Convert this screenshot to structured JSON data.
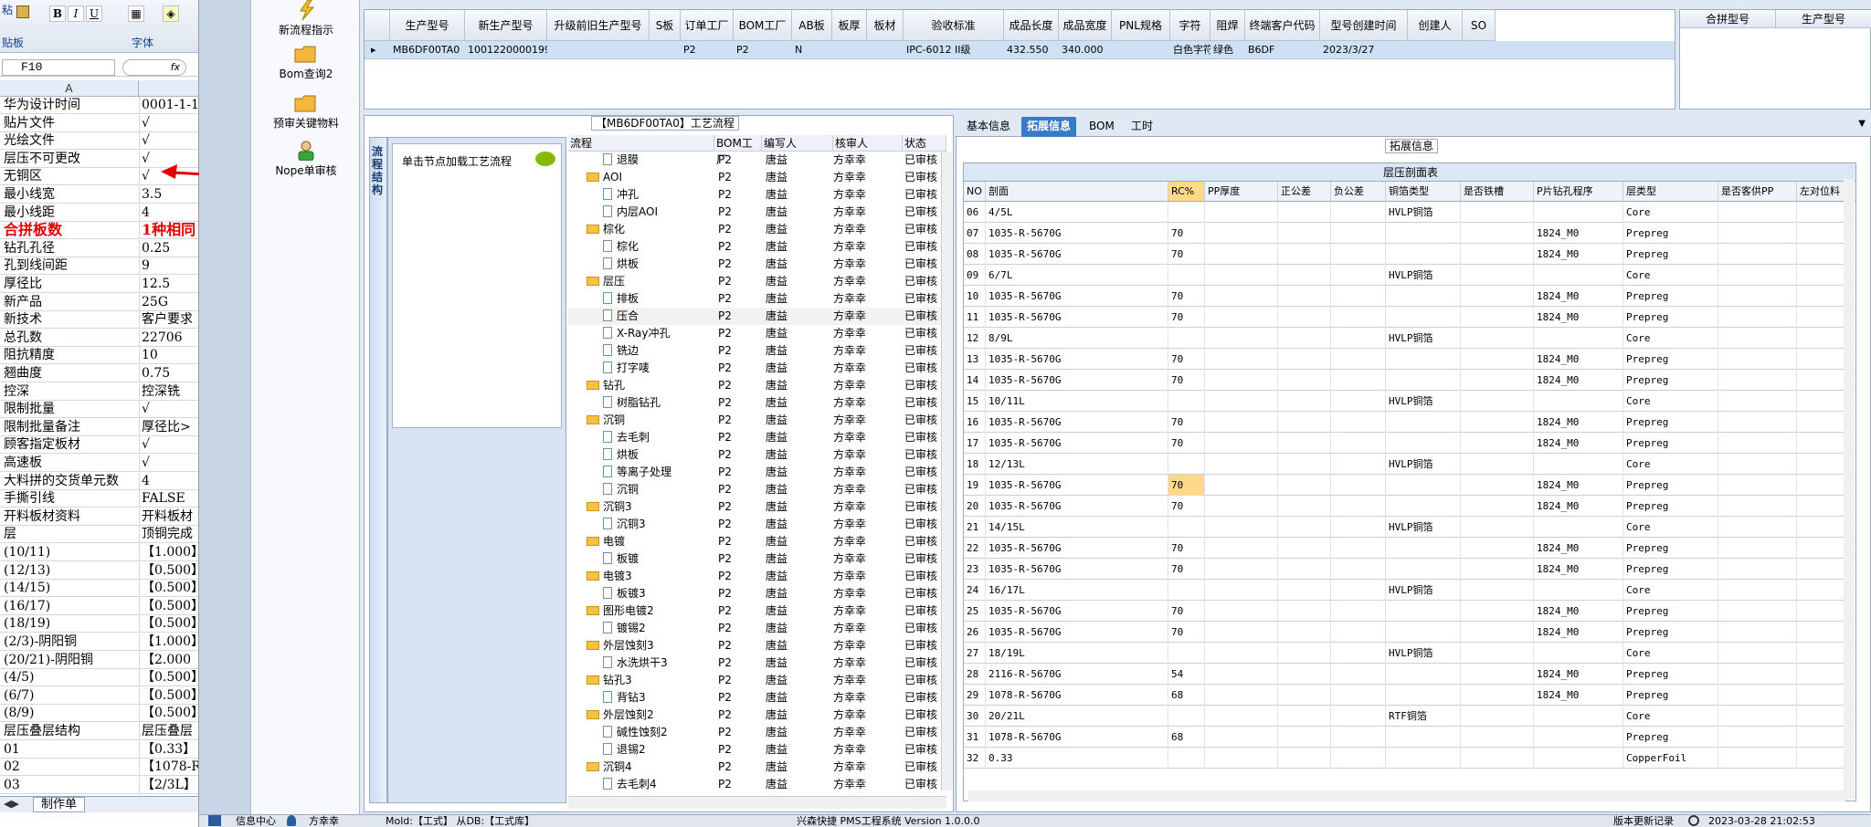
{
  "excel": {
    "ribbon": {
      "group_label": "字体",
      "left_label": "粘",
      "left_label2": "贴板",
      "bold": "B",
      "italic": "I",
      "underline": "U"
    },
    "name_box": "F10",
    "fx": "fx",
    "column_a": "A",
    "rows": [
      [
        "华为设计时间",
        "0001-1-1"
      ],
      [
        "贴片文件",
        "√"
      ],
      [
        "光绘文件",
        "√"
      ],
      [
        "层压不可更改",
        "√"
      ],
      [
        "无铜区",
        "√"
      ],
      [
        "最小线宽",
        "3.5"
      ],
      [
        "最小线距",
        "4"
      ],
      [
        "合拼板数",
        "1种相同"
      ],
      [
        "钻孔孔径",
        "0.25"
      ],
      [
        "孔到线间距",
        "9"
      ],
      [
        "厚径比",
        "12.5"
      ],
      [
        "新产品",
        "25G"
      ],
      [
        "新技术",
        "客户要求"
      ],
      [
        "总孔数",
        "22706"
      ],
      [
        "阻抗精度",
        "10"
      ],
      [
        "翘曲度",
        "0.75"
      ],
      [
        "控深",
        "控深铣"
      ],
      [
        "限制批量",
        "√"
      ],
      [
        "限制批量备注",
        "厚径比>"
      ],
      [
        "顾客指定板材",
        "√"
      ],
      [
        "高速板",
        "√"
      ],
      [
        "大料拼的交货单元数",
        "4"
      ],
      [
        "手撕引线",
        "FALSE"
      ],
      [
        "开料板材资料",
        "开料板材"
      ],
      [
        "层",
        "顶铜完成"
      ],
      [
        "(10/11)",
        "【1.000】"
      ],
      [
        "(12/13)",
        "【0.500】"
      ],
      [
        "(14/15)",
        "【0.500】"
      ],
      [
        "(16/17)",
        "【0.500】"
      ],
      [
        "(18/19)",
        "【0.500】"
      ],
      [
        "(2/3)-阴阳铜",
        "【1.000】"
      ],
      [
        "(20/21)-阴阳铜",
        "【2.000"
      ],
      [
        "(4/5)",
        "【0.500】"
      ],
      [
        "(6/7)",
        "【0.500】"
      ],
      [
        "(8/9)",
        "【0.500】"
      ],
      [
        "层压叠层结构",
        "层压叠层"
      ],
      [
        "01",
        "【0.33】"
      ],
      [
        "02",
        "【1078-R"
      ],
      [
        "03",
        "【2/3L】"
      ]
    ],
    "sheet_tab": "制作单"
  },
  "nav": {
    "items": [
      "新流程指示",
      "Bom查询2",
      "预审关键物料",
      "Nope单审核"
    ]
  },
  "top_grid": {
    "headers": [
      "生产型号",
      "新生产型号",
      "升级前旧生产型号",
      "S板",
      "订单工厂",
      "BOM工厂",
      "AB板",
      "板厚",
      "板材",
      "验收标准",
      "成品长度",
      "成品宽度",
      "PNL规格",
      "字符",
      "阻焊",
      "终端客户代码",
      "型号创建时间",
      "创建人",
      "SO"
    ],
    "row": [
      "MB6DF00TA0",
      "10012200001995",
      "",
      "",
      "P2",
      "P2",
      "N",
      "",
      "",
      "IPC-6012 II级",
      "432.550",
      "340.000",
      "",
      "白色字符",
      "绿色",
      "B6DF",
      "2023/3/27",
      "",
      ""
    ],
    "right_headers": [
      "合拼型号",
      "生产型号"
    ]
  },
  "process": {
    "title": "【MB6DF00TA0】工艺流程",
    "side_tab": "流程结构",
    "click_label": "单击节点加载工艺流程",
    "headers": [
      "流程",
      "BOM工厂",
      "编写人",
      "核审人",
      "状态"
    ],
    "nodes": [
      {
        "name": "退膜",
        "level": 2,
        "folder": false
      },
      {
        "name": "AOI",
        "level": 1,
        "folder": true
      },
      {
        "name": "冲孔",
        "level": 2,
        "folder": false
      },
      {
        "name": "内层AOI",
        "level": 2,
        "folder": false
      },
      {
        "name": "棕化",
        "level": 1,
        "folder": true
      },
      {
        "name": "棕化",
        "level": 2,
        "folder": false
      },
      {
        "name": "烘板",
        "level": 2,
        "folder": false
      },
      {
        "name": "层压",
        "level": 1,
        "folder": true
      },
      {
        "name": "排板",
        "level": 2,
        "folder": false
      },
      {
        "name": "压合",
        "level": 2,
        "folder": false,
        "selected": true
      },
      {
        "name": "X-Ray冲孔",
        "level": 2,
        "folder": false
      },
      {
        "name": "铣边",
        "level": 2,
        "folder": false
      },
      {
        "name": "打字唛",
        "level": 2,
        "folder": false
      },
      {
        "name": "钻孔",
        "level": 1,
        "folder": true
      },
      {
        "name": "树脂钻孔",
        "level": 2,
        "folder": false
      },
      {
        "name": "沉铜",
        "level": 1,
        "folder": true
      },
      {
        "name": "去毛刺",
        "level": 2,
        "folder": false
      },
      {
        "name": "烘板",
        "level": 2,
        "folder": false
      },
      {
        "name": "等离子处理",
        "level": 2,
        "folder": false
      },
      {
        "name": "沉铜",
        "level": 2,
        "folder": false
      },
      {
        "name": "沉铜3",
        "level": 1,
        "folder": true
      },
      {
        "name": "沉铜3",
        "level": 2,
        "folder": false
      },
      {
        "name": "电镀",
        "level": 1,
        "folder": true
      },
      {
        "name": "板镀",
        "level": 2,
        "folder": false
      },
      {
        "name": "电镀3",
        "level": 1,
        "folder": true
      },
      {
        "name": "板镀3",
        "level": 2,
        "folder": false
      },
      {
        "name": "图形电镀2",
        "level": 1,
        "folder": true
      },
      {
        "name": "镀锡2",
        "level": 2,
        "folder": false
      },
      {
        "name": "外层蚀刻3",
        "level": 1,
        "folder": true
      },
      {
        "name": "水洗烘干3",
        "level": 2,
        "folder": false
      },
      {
        "name": "钻孔3",
        "level": 1,
        "folder": true
      },
      {
        "name": "背钻3",
        "level": 2,
        "folder": false
      },
      {
        "name": "外层蚀刻2",
        "level": 1,
        "folder": true
      },
      {
        "name": "碱性蚀刻2",
        "level": 2,
        "folder": false
      },
      {
        "name": "退锡2",
        "level": 2,
        "folder": false
      },
      {
        "name": "沉铜4",
        "level": 1,
        "folder": true
      },
      {
        "name": "去毛刺4",
        "level": 2,
        "folder": false
      }
    ],
    "bom_factory": "P2",
    "writer": "唐益",
    "reviewer": "方幸幸",
    "status": "已审核"
  },
  "detail": {
    "tabs": [
      "基本信息",
      "拓展信息",
      "BOM",
      "工时"
    ],
    "active_tab": 1,
    "ext_label": "拓展信息",
    "table_title": "层压剖面表",
    "headers": [
      "NO",
      "剖面",
      "RC%",
      "PP厚度",
      "正公差",
      "负公差",
      "铜箔类型",
      "是否铁槽",
      "P片钻孔程序",
      "层类型",
      "是否客供PP",
      "左对位料"
    ],
    "rows": [
      [
        "06",
        "4/5L",
        "",
        "",
        "",
        "",
        "HVLP铜箔",
        "",
        "",
        "Core",
        "",
        ""
      ],
      [
        "07",
        "1035-R-5670G",
        "70",
        "",
        "",
        "",
        "",
        "",
        "1824_M0",
        "Prepreg",
        "",
        ""
      ],
      [
        "08",
        "1035-R-5670G",
        "70",
        "",
        "",
        "",
        "",
        "",
        "1824_M0",
        "Prepreg",
        "",
        ""
      ],
      [
        "09",
        "6/7L",
        "",
        "",
        "",
        "",
        "HVLP铜箔",
        "",
        "",
        "Core",
        "",
        ""
      ],
      [
        "10",
        "1035-R-5670G",
        "70",
        "",
        "",
        "",
        "",
        "",
        "1824_M0",
        "Prepreg",
        "",
        ""
      ],
      [
        "11",
        "1035-R-5670G",
        "70",
        "",
        "",
        "",
        "",
        "",
        "1824_M0",
        "Prepreg",
        "",
        ""
      ],
      [
        "12",
        "8/9L",
        "",
        "",
        "",
        "",
        "HVLP铜箔",
        "",
        "",
        "Core",
        "",
        ""
      ],
      [
        "13",
        "1035-R-5670G",
        "70",
        "",
        "",
        "",
        "",
        "",
        "1824_M0",
        "Prepreg",
        "",
        ""
      ],
      [
        "14",
        "1035-R-5670G",
        "70",
        "",
        "",
        "",
        "",
        "",
        "1824_M0",
        "Prepreg",
        "",
        ""
      ],
      [
        "15",
        "10/11L",
        "",
        "",
        "",
        "",
        "HVLP铜箔",
        "",
        "",
        "Core",
        "",
        ""
      ],
      [
        "16",
        "1035-R-5670G",
        "70",
        "",
        "",
        "",
        "",
        "",
        "1824_M0",
        "Prepreg",
        "",
        ""
      ],
      [
        "17",
        "1035-R-5670G",
        "70",
        "",
        "",
        "",
        "",
        "",
        "1824_M0",
        "Prepreg",
        "",
        ""
      ],
      [
        "18",
        "12/13L",
        "",
        "",
        "",
        "",
        "HVLP铜箔",
        "",
        "",
        "Core",
        "",
        ""
      ],
      [
        "19",
        "1035-R-5670G",
        "70",
        "",
        "",
        "",
        "",
        "",
        "1824_M0",
        "Prepreg",
        "",
        ""
      ],
      [
        "20",
        "1035-R-5670G",
        "70",
        "",
        "",
        "",
        "",
        "",
        "1824_M0",
        "Prepreg",
        "",
        ""
      ],
      [
        "21",
        "14/15L",
        "",
        "",
        "",
        "",
        "HVLP铜箔",
        "",
        "",
        "Core",
        "",
        ""
      ],
      [
        "22",
        "1035-R-5670G",
        "70",
        "",
        "",
        "",
        "",
        "",
        "1824_M0",
        "Prepreg",
        "",
        ""
      ],
      [
        "23",
        "1035-R-5670G",
        "70",
        "",
        "",
        "",
        "",
        "",
        "1824_M0",
        "Prepreg",
        "",
        ""
      ],
      [
        "24",
        "16/17L",
        "",
        "",
        "",
        "",
        "HVLP铜箔",
        "",
        "",
        "Core",
        "",
        ""
      ],
      [
        "25",
        "1035-R-5670G",
        "70",
        "",
        "",
        "",
        "",
        "",
        "1824_M0",
        "Prepreg",
        "",
        ""
      ],
      [
        "26",
        "1035-R-5670G",
        "70",
        "",
        "",
        "",
        "",
        "",
        "1824_M0",
        "Prepreg",
        "",
        ""
      ],
      [
        "27",
        "18/19L",
        "",
        "",
        "",
        "",
        "HVLP铜箔",
        "",
        "",
        "Core",
        "",
        ""
      ],
      [
        "28",
        "2116-R-5670G",
        "54",
        "",
        "",
        "",
        "",
        "",
        "1824_M0",
        "Prepreg",
        "",
        ""
      ],
      [
        "29",
        "1078-R-5670G",
        "68",
        "",
        "",
        "",
        "",
        "",
        "1824_M0",
        "Prepreg",
        "",
        ""
      ],
      [
        "30",
        "20/21L",
        "",
        "",
        "",
        "",
        "RTF铜箔",
        "",
        "",
        "Core",
        "",
        ""
      ],
      [
        "31",
        "1078-R-5670G",
        "68",
        "",
        "",
        "",
        "",
        "",
        "",
        "Prepreg",
        "",
        ""
      ],
      [
        "32",
        "0.33",
        "",
        "",
        "",
        "",
        "",
        "",
        "",
        "CopperFoil",
        "",
        ""
      ]
    ],
    "highlight_row_no": "19"
  },
  "status_bar": {
    "items": [
      "信息中心",
      "方幸幸",
      "Mold:【工式】 从DB:【工式库】",
      "兴森快捷 PMS工程系统 Version 1.0.0.0",
      "版本更新记录",
      "2023-03-28 21:02:53"
    ]
  },
  "colors": {
    "accent": "#3a79c4",
    "highlight": "#ffd98a",
    "arrow": "#e00000",
    "selected_row": "#cfe0f5"
  }
}
